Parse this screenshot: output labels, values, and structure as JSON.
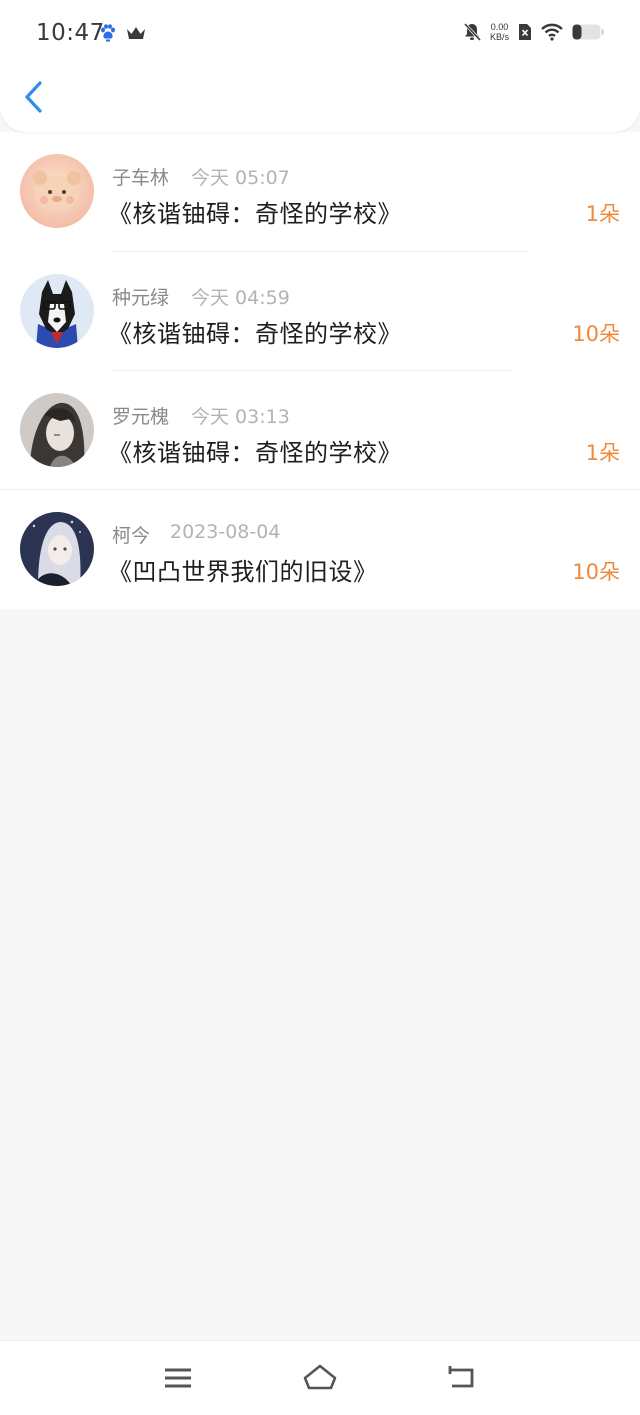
{
  "status_bar": {
    "time": "10:47",
    "net_speed_value": "0.00",
    "net_speed_unit": "KB/s",
    "icons": [
      "paw-icon",
      "crown-icon",
      "bell-off-icon",
      "sim-off-icon",
      "wifi-icon",
      "battery-icon"
    ]
  },
  "nav": {
    "back_icon": "chevron-left-icon"
  },
  "records": [
    {
      "name": "子车林",
      "time": "今天 05:07",
      "title": "《核谐铀碍：奇怪的学校》",
      "amount": "1朵"
    },
    {
      "name": "种元绿",
      "time": "今天 04:59",
      "title": "《核谐铀碍：奇怪的学校》",
      "amount": "10朵"
    },
    {
      "name": "罗元槐",
      "time": "今天 03:13",
      "title": "《核谐铀碍：奇怪的学校》",
      "amount": "1朵"
    },
    {
      "name": "柯今",
      "time": "2023-08-04",
      "title": "《凹凸世界我们的旧设》",
      "amount": "10朵"
    }
  ],
  "colors": {
    "accent_blue": "#2d8cf0",
    "amount_orange": "#ef8a3c",
    "background": "#f8f7f8"
  },
  "bottom_nav": {
    "icons": [
      "menu-icon",
      "home-icon",
      "back-icon"
    ]
  }
}
